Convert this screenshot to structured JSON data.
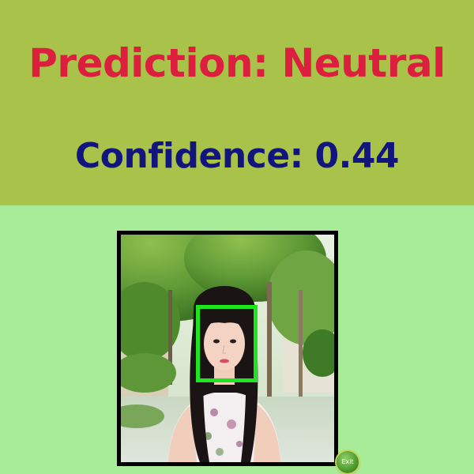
{
  "result": {
    "prediction_text": "Prediction: Neutral",
    "confidence_text": "Confidence: 0.44"
  },
  "colors": {
    "header_bg": "#a9c24a",
    "page_bg": "#a8ec9a",
    "prediction_color": "#dc1e3f",
    "confidence_color": "#13157e",
    "face_box_color": "#1ee61e"
  },
  "image": {
    "subject": "woman-portrait-outdoors"
  },
  "controls": {
    "exit_label": "Exit"
  }
}
